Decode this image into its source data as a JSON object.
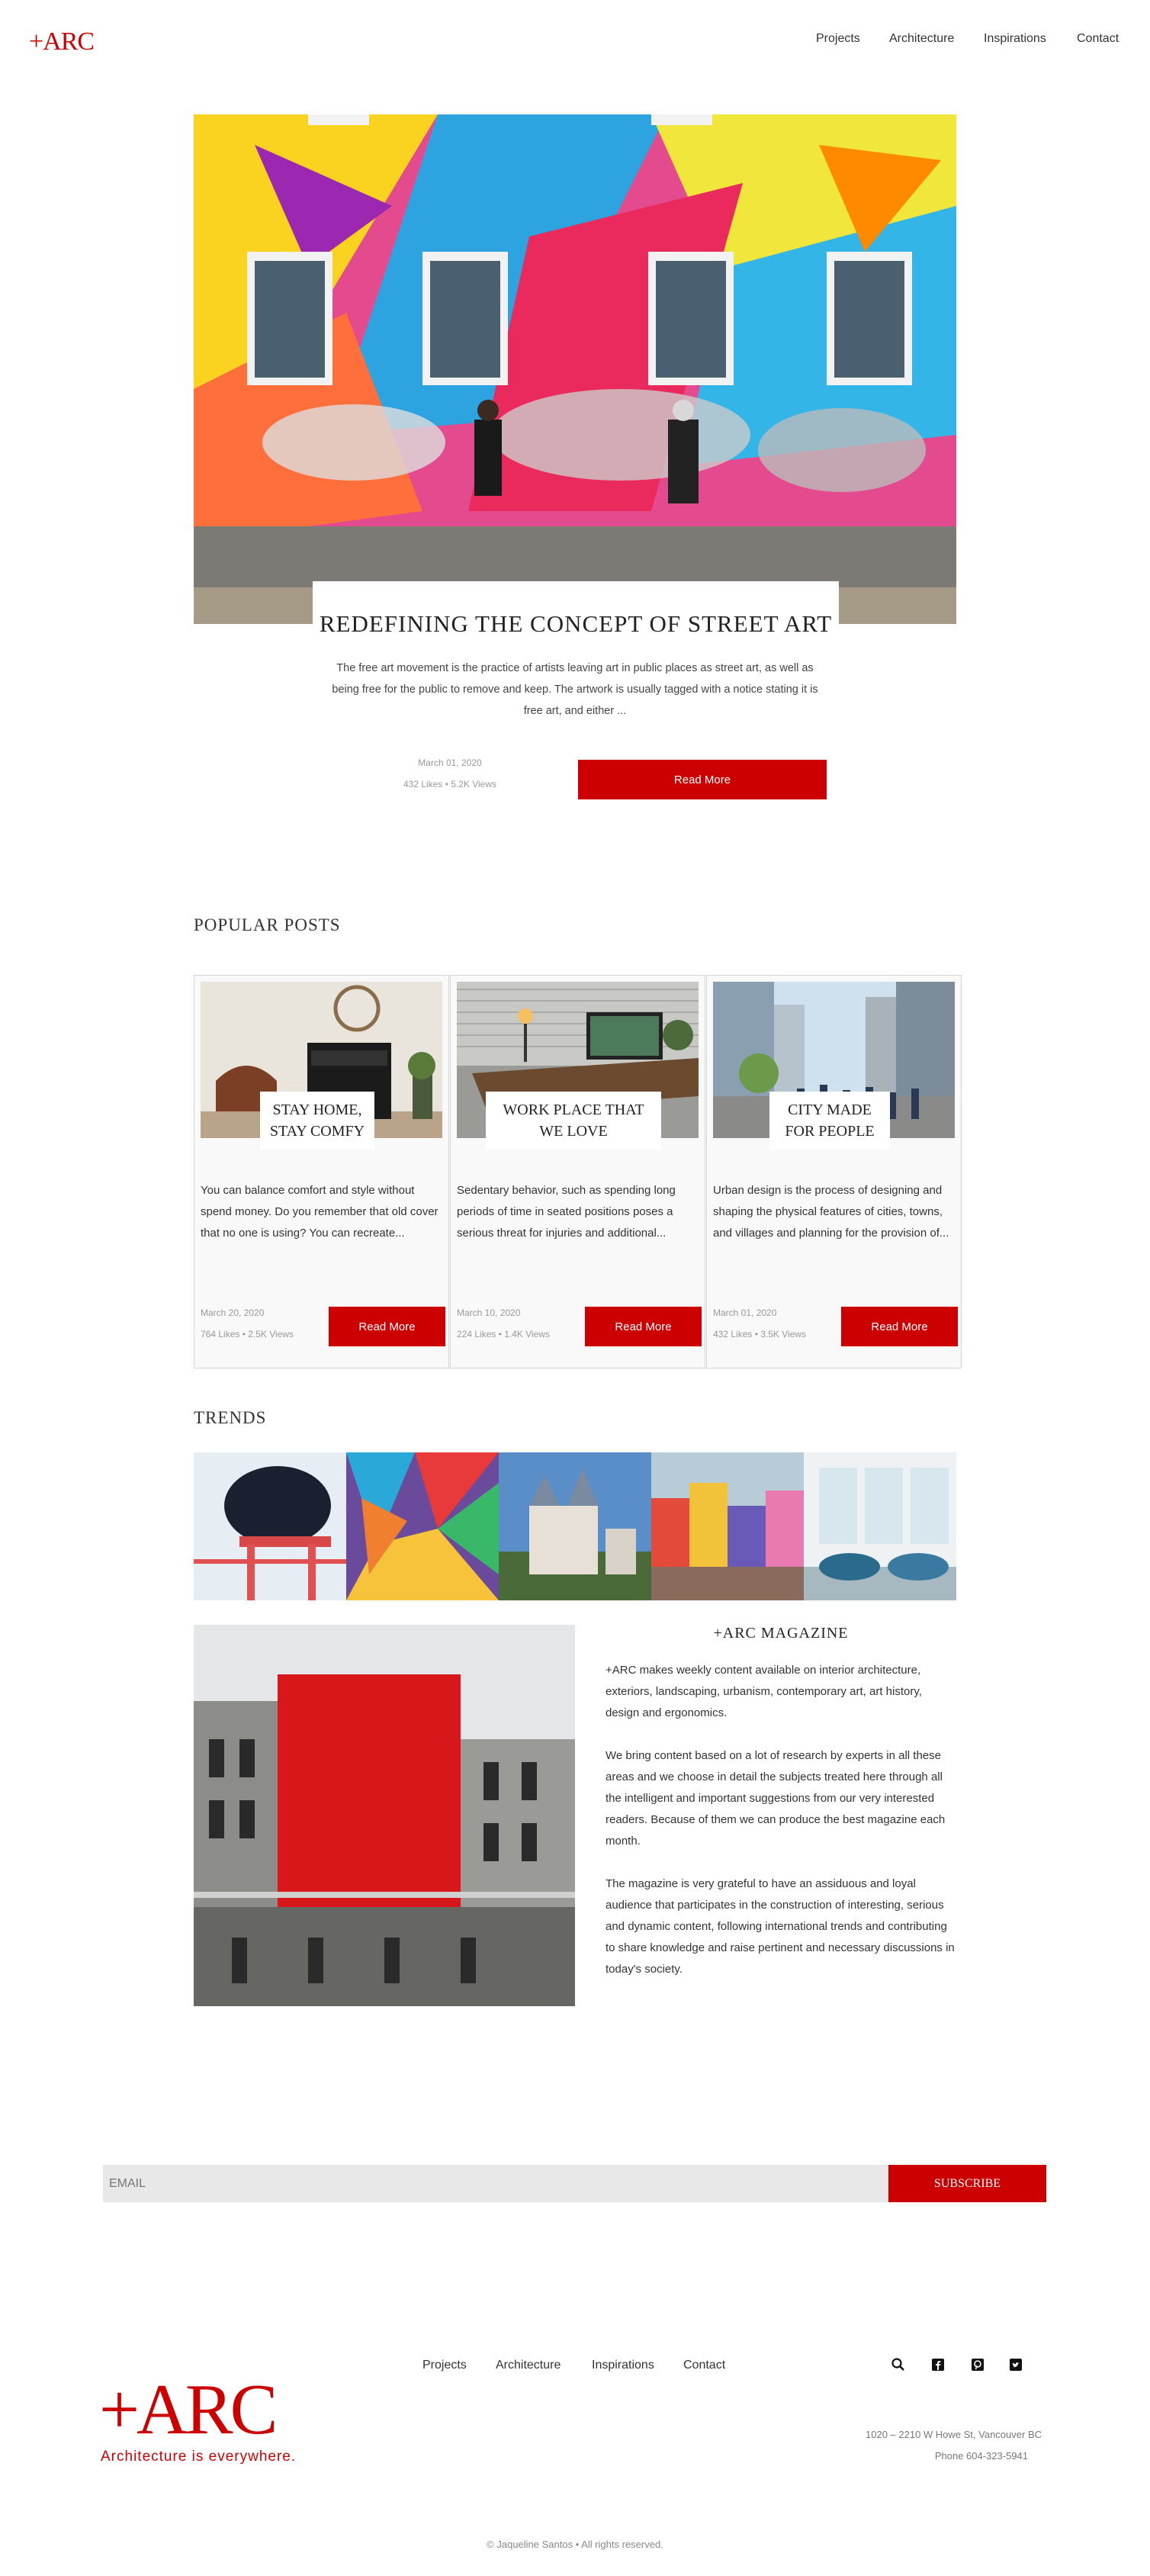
{
  "header": {
    "logo": "+ARC",
    "nav": [
      "Projects",
      "Architecture",
      "Inspirations",
      "Contact"
    ]
  },
  "hero": {
    "title": "REDEFINING THE CONCEPT OF STREET ART",
    "text": "The free art movement is the practice of artists leaving art in public places as street art, as well as being free for the public to remove and keep. The artwork is usually tagged with a notice stating it is free art, and either ...",
    "date": "March 01, 2020",
    "stats": "432 Likes • 5.2K Views",
    "button": "Read More"
  },
  "popular": {
    "title": "POPULAR POSTS",
    "cards": [
      {
        "label_line1": "STAY HOME,",
        "label_line2": "STAY COMFY",
        "text": "You can balance comfort and style without spend money. Do you remember that old cover that no one is using? You can recreate...",
        "date": "March 20, 2020",
        "stats": "764 Likes • 2.5K Views",
        "button": "Read More"
      },
      {
        "label_line1": "WORK PLACE THAT",
        "label_line2": "WE LOVE",
        "text": "Sedentary behavior, such as spending long periods of time in seated positions poses a serious threat for injuries and additional...",
        "date": "March 10, 2020",
        "stats": "224 Likes • 1.4K Views",
        "button": "Read More"
      },
      {
        "label_line1": "CITY MADE",
        "label_line2": "FOR PEOPLE",
        "text": "Urban design is the process of designing and shaping the physical features of cities, towns, and villages and planning for the provision of...",
        "date": "March 01, 2020",
        "stats": "432 Likes • 3.5K Views",
        "button": "Read More"
      }
    ]
  },
  "trends": {
    "title": "TRENDS"
  },
  "magazine": {
    "title": "+ARC MAGAZINE",
    "p1": "+ARC makes weekly content available on interior architecture, exteriors, landscaping, urbanism, contemporary art, art history, design and ergonomics.",
    "p2": "We bring content based on a lot of research by experts in all these areas and we choose in detail the subjects treated here through all the intelligent and important suggestions from our very interested readers. Because of them we can produce the best magazine each month.",
    "p3": "The magazine is very grateful to have an assiduous and loyal audience that participates in the construction of interesting, serious and dynamic content, following international trends and contributing to share knowledge and raise pertinent and necessary discussions in today's society."
  },
  "subscribe": {
    "placeholder": "EMAIL",
    "button": "SUBSCRIBE"
  },
  "footer": {
    "nav": [
      "Projects",
      "Architecture",
      "Inspirations",
      "Contact"
    ],
    "logo": "+ARC",
    "tagline": "Architecture is everywhere.",
    "address": "1020 – 2210 W Howe St, Vancouver BC",
    "phone": "Phone 604-323-5941",
    "copyright": "© Jaqueline Santos • All rights reserved.",
    "social_icons": [
      "search-icon",
      "facebook-icon",
      "pinterest-icon",
      "twitter-icon"
    ]
  },
  "colors": {
    "accent": "#cc0000",
    "card_bg": "#f9f9f9",
    "input_bg": "#e8e8e8"
  }
}
